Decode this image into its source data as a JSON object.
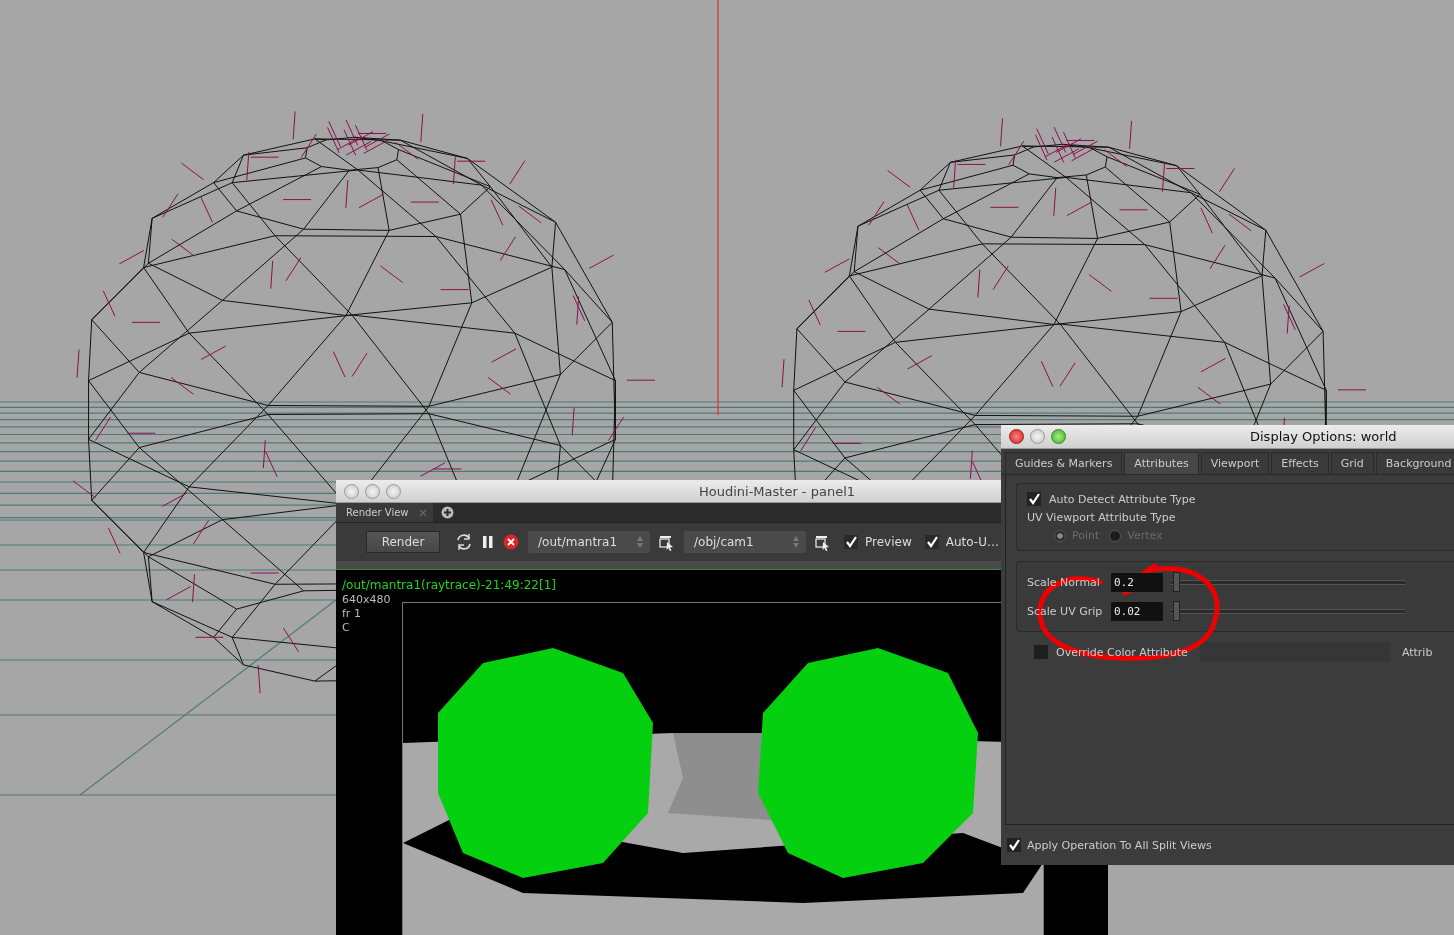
{
  "render_window": {
    "title": "Houdini-Master - panel1",
    "tabs": [
      {
        "label": "Render View",
        "selected": true
      }
    ],
    "toolbar": {
      "render_button": "Render",
      "renderer": "/out/mantra1",
      "camera": "/obj/cam1",
      "toggles": [
        {
          "label": "Preview",
          "checked": true
        },
        {
          "label": "Auto-U…",
          "checked": true
        }
      ]
    },
    "info": {
      "header": "/out/mantra1(raytrace)-21:49:22[1]",
      "lines": [
        "640x480",
        "fr 1",
        "C"
      ]
    }
  },
  "display_options": {
    "title": "Display Options:  world",
    "tabs": [
      {
        "label": "Guides & Markers",
        "selected": false
      },
      {
        "label": "Attributes",
        "selected": true
      },
      {
        "label": "Viewport",
        "selected": false
      },
      {
        "label": "Effects",
        "selected": false
      },
      {
        "label": "Grid",
        "selected": false
      },
      {
        "label": "Background",
        "selected": false
      }
    ],
    "auto_detect": {
      "label": "Auto Detect Attribute Type",
      "checked": true
    },
    "uv_type": {
      "label": "UV Viewport Attribute Type",
      "disabled": true,
      "options": [
        {
          "label": "Point",
          "selected": true
        },
        {
          "label": "Vertex",
          "selected": false
        }
      ]
    },
    "sliders": [
      {
        "label": "Scale Normal",
        "value": "0.2",
        "level": 0.01
      },
      {
        "label": "Scale UV Grip",
        "value": "0.02",
        "level": 0.01
      }
    ],
    "override": {
      "label": "Override Color Attribute",
      "checked": false,
      "side_label": "Attrib"
    },
    "apply": {
      "label": "Apply Operation To All Split Views",
      "checked": true
    }
  }
}
